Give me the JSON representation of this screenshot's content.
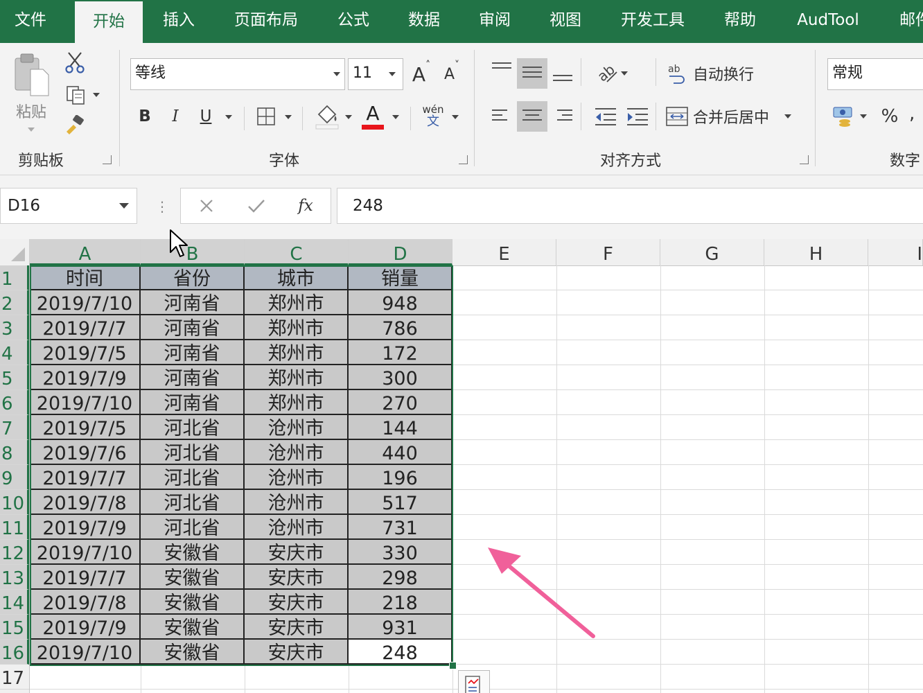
{
  "tabs": [
    {
      "label": "文件"
    },
    {
      "label": "开始"
    },
    {
      "label": "插入"
    },
    {
      "label": "页面布局"
    },
    {
      "label": "公式"
    },
    {
      "label": "数据"
    },
    {
      "label": "审阅"
    },
    {
      "label": "视图"
    },
    {
      "label": "开发工具"
    },
    {
      "label": "帮助"
    },
    {
      "label": "AudTool"
    },
    {
      "label": "邮件"
    }
  ],
  "active_tab": "开始",
  "ribbon": {
    "clipboard": {
      "paste_label": "粘贴",
      "group_label": "剪贴板"
    },
    "font": {
      "font_name": "等线",
      "font_size": "11",
      "bold": "B",
      "italic": "I",
      "underline": "U",
      "group_label": "字体",
      "grow_font": "A",
      "shrink_font": "A",
      "phonetic_top": "wén",
      "phonetic_bottom": "文",
      "font_color_glyph": "A"
    },
    "alignment": {
      "wrap_text": "自动换行",
      "merge_center": "合并后居中",
      "group_label": "对齐方式"
    },
    "number": {
      "format": "常规",
      "percent": "%",
      "comma": ",",
      "group_label": "数字"
    }
  },
  "formula_bar": {
    "name_box": "D16",
    "formula": "248",
    "fx": "fx"
  },
  "columns": [
    "A",
    "B",
    "C",
    "D",
    "E",
    "F",
    "G",
    "H",
    "I"
  ],
  "rows": [
    "1",
    "2",
    "3",
    "4",
    "5",
    "6",
    "7",
    "8",
    "9",
    "10",
    "11",
    "12",
    "13",
    "14",
    "15",
    "16",
    "17"
  ],
  "table": {
    "headers": [
      "时间",
      "省份",
      "城市",
      "销量"
    ],
    "rows": [
      [
        "2019/7/10",
        "河南省",
        "郑州市",
        "948"
      ],
      [
        "2019/7/7",
        "河南省",
        "郑州市",
        "786"
      ],
      [
        "2019/7/5",
        "河南省",
        "郑州市",
        "172"
      ],
      [
        "2019/7/9",
        "河南省",
        "郑州市",
        "300"
      ],
      [
        "2019/7/10",
        "河南省",
        "郑州市",
        "270"
      ],
      [
        "2019/7/5",
        "河北省",
        "沧州市",
        "144"
      ],
      [
        "2019/7/6",
        "河北省",
        "沧州市",
        "440"
      ],
      [
        "2019/7/7",
        "河北省",
        "沧州市",
        "196"
      ],
      [
        "2019/7/8",
        "河北省",
        "沧州市",
        "517"
      ],
      [
        "2019/7/9",
        "河北省",
        "沧州市",
        "731"
      ],
      [
        "2019/7/10",
        "安徽省",
        "安庆市",
        "330"
      ],
      [
        "2019/7/7",
        "安徽省",
        "安庆市",
        "298"
      ],
      [
        "2019/7/8",
        "安徽省",
        "安庆市",
        "218"
      ],
      [
        "2019/7/9",
        "安徽省",
        "安庆市",
        "931"
      ],
      [
        "2019/7/10",
        "安徽省",
        "安庆市",
        "248"
      ]
    ]
  },
  "colors": {
    "accent": "#217346",
    "annotation_arrow": "#f0609a",
    "selection_fill": "#c9c9c9",
    "header_fill": "#b1b8c2"
  },
  "icons": [
    "paste-icon",
    "cut-icon",
    "copy-icon",
    "format-painter-icon",
    "border-icon",
    "fill-color-icon",
    "font-color-icon",
    "orientation-icon",
    "indent-icon",
    "wrap-icon",
    "merge-icon",
    "currency-icon",
    "cancel-icon",
    "enter-icon",
    "quick-analysis-icon",
    "cursor-icon",
    "annotation-arrow-icon"
  ]
}
